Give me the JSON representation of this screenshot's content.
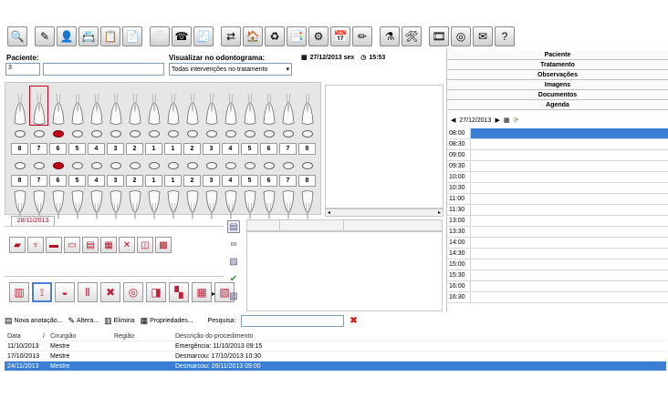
{
  "toolbar": {
    "icons": [
      "patient-search-icon",
      "patient-record-icon",
      "add-patient-icon",
      "agenda-card-icon",
      "clinical-report-icon",
      "documents-icon",
      "xray-viewer-icon",
      "phonebook-icon",
      "cash-register-icon",
      "transfer-icon",
      "home-chart-icon",
      "payments-icon",
      "treatment-plan-icon",
      "prosthesis-icon",
      "schedule-calendar-icon",
      "notes-icon",
      "lab-icon",
      "settings-icon",
      "video-icon",
      "cd-icon",
      "messages-icon",
      "help-icon"
    ],
    "glyphs": [
      "🔍",
      "✎",
      "👤",
      "📇",
      "📋",
      "📄",
      "🦷",
      "☎",
      "🧾",
      "⇄",
      "🏠",
      "♻",
      "📑",
      "⚙",
      "📅",
      "✏",
      "⚗",
      "🛠",
      "🎞",
      "◎",
      "✉",
      "?"
    ]
  },
  "patient": {
    "label": "Paciente:",
    "id": "3",
    "name": ""
  },
  "view": {
    "label": "Visualizar no odontograma:",
    "selected": "Todas intervenções no tratamento"
  },
  "datetime": {
    "date": "27/12/2013 sex",
    "time": "15:53"
  },
  "odontogram": {
    "upper_numbers": [
      "8",
      "7",
      "6",
      "5",
      "4",
      "3",
      "2",
      "1",
      "1",
      "2",
      "3",
      "4",
      "5",
      "6",
      "7",
      "8"
    ],
    "lower_numbers": [
      "8",
      "7",
      "6",
      "5",
      "4",
      "3",
      "2",
      "1",
      "1",
      "2",
      "3",
      "4",
      "5",
      "6",
      "7",
      "8"
    ],
    "tab_date": "28/11/2013"
  },
  "right_panel": {
    "sections": [
      "Paciente",
      "Tratamento",
      "Observações",
      "Imagens",
      "Documentos",
      "Agenda"
    ],
    "agenda_date": "27/12/2013",
    "times": [
      "08:00",
      "08:30",
      "09:00",
      "09:30",
      "10:00",
      "10:30",
      "11:00",
      "11:30",
      "13:00",
      "13:30",
      "14:00",
      "14:30",
      "15:00",
      "15:30",
      "16:00",
      "16:30"
    ]
  },
  "bottom_bar": {
    "new_note": "Nova anotação...",
    "edit": "Altera...",
    "delete": "Elimina",
    "properties": "Propriedades...",
    "search_label": "Pesquisa:",
    "search_value": ""
  },
  "table": {
    "headers": [
      "Data",
      "Cirurgião",
      "Região",
      "Descrição do procedimento"
    ],
    "rows": [
      [
        "11/10/2013",
        "Mestre",
        "",
        "Emergência: 11/10/2013 09:15"
      ],
      [
        "17/10/2013",
        "Mestre",
        "",
        "Desmarcou: 17/10/2013 10:30"
      ],
      [
        "24/11/2013",
        "Mestre",
        "",
        "Desmarcou: 26/11/2013 09:00"
      ]
    ],
    "selected_row": 2,
    "sort_marker": "/"
  },
  "colors": {
    "selection": "#3a7fd5",
    "marker_red": "#c0001b"
  }
}
